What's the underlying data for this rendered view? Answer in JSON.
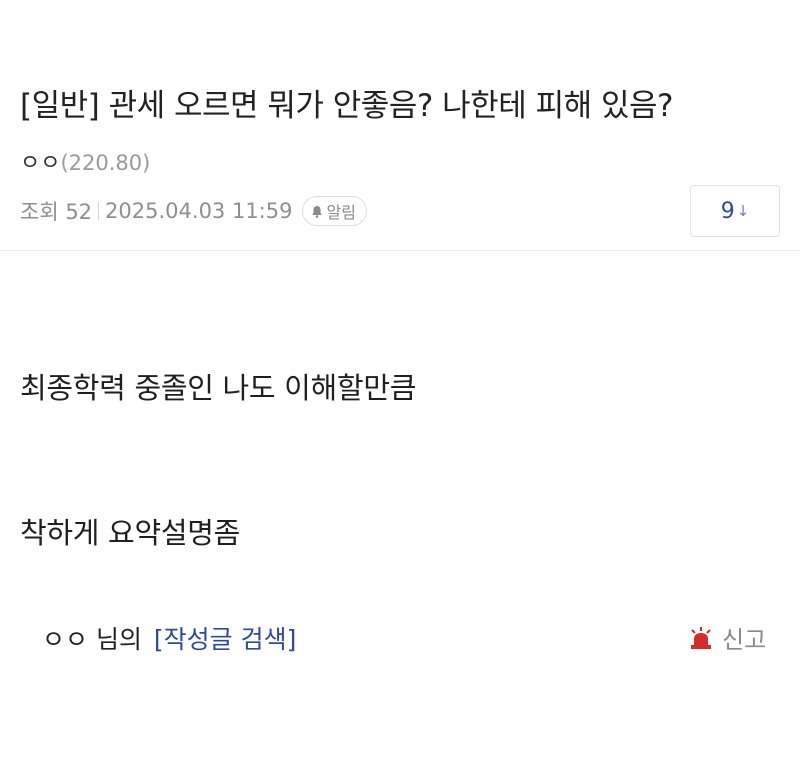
{
  "post": {
    "title": "[일반] 관세 오르면 뭐가 안좋음? 나한테 피해 있음?",
    "author": "ㅇㅇ",
    "author_ip": "(220.80)",
    "views_label": "조회 52",
    "datetime": "2025.04.03 11:59",
    "alarm_label": "알림",
    "comment_count": "9",
    "comment_arrow": "↓",
    "body_lines": [
      "최종학력 중졸인 나도 이해할만큼",
      "착하게 요약설명좀"
    ]
  },
  "footer": {
    "author": "ㅇㅇ",
    "suffix": " 님의",
    "search_link": "[작성글 검색]",
    "report_label": "신고"
  },
  "icons": {
    "alarm": "bell-icon",
    "report": "siren-icon"
  },
  "colors": {
    "link": "#2f4a9a",
    "report_icon": "#d42b2b",
    "meta": "#8f8f8f"
  }
}
